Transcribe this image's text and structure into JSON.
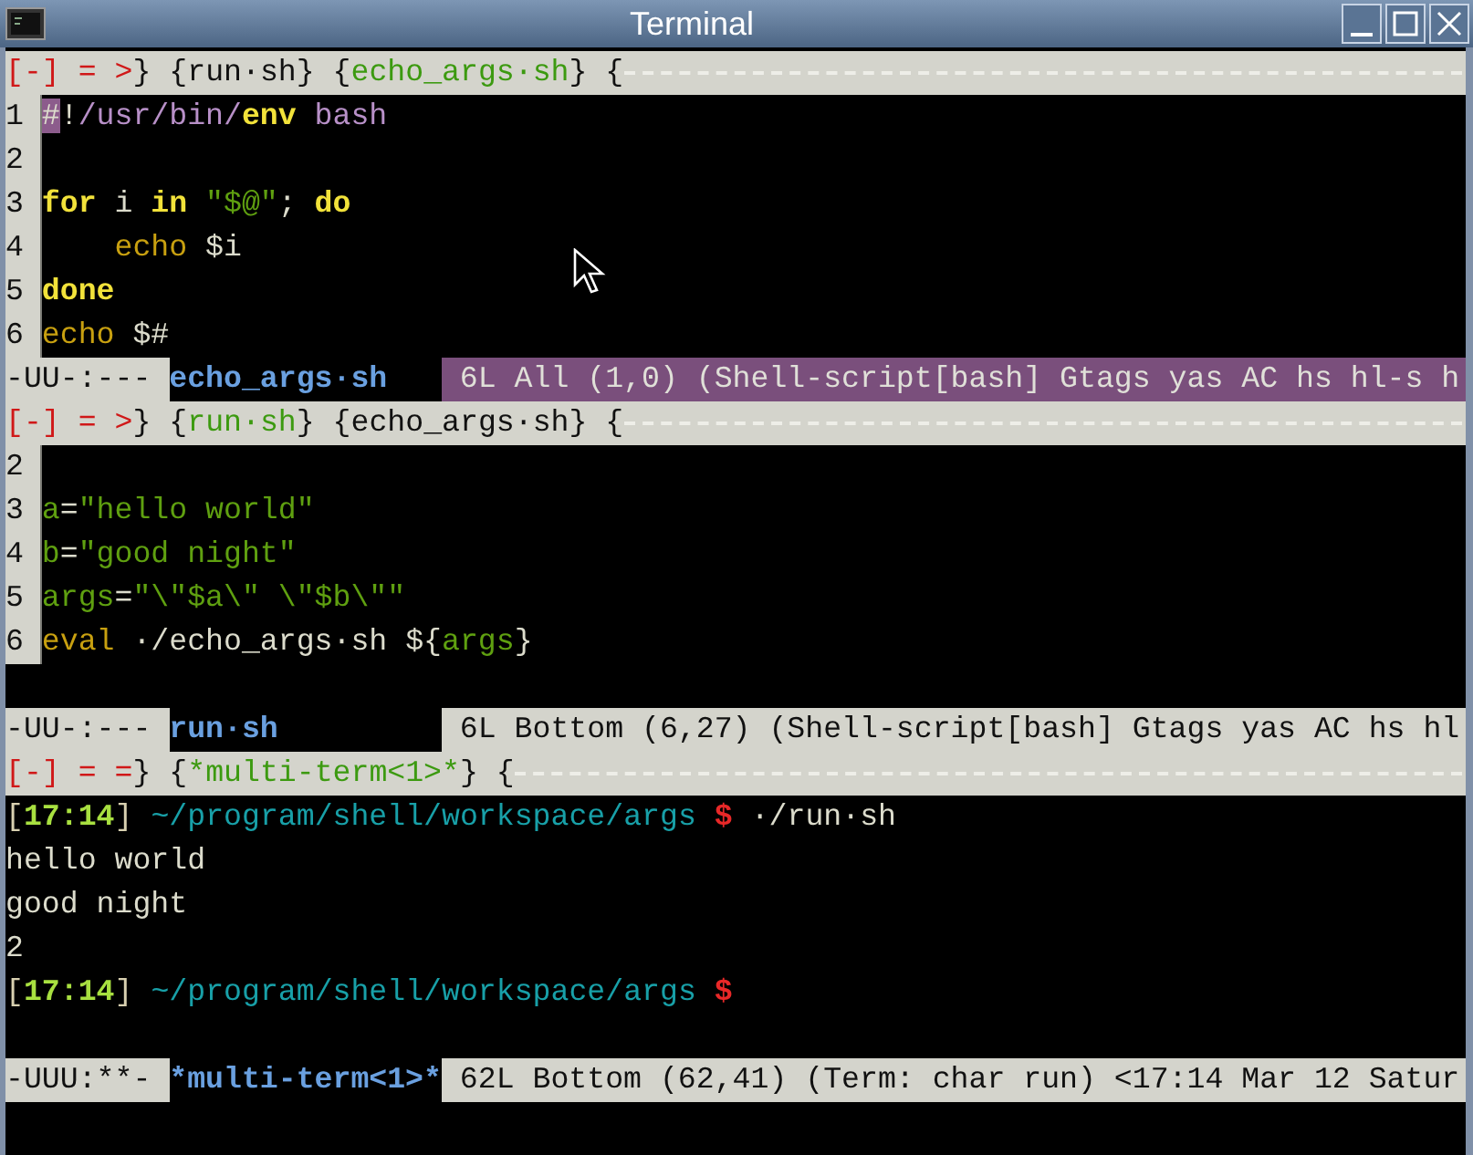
{
  "window": {
    "title": "Terminal"
  },
  "panes": [
    {
      "kind": "editor",
      "active": true,
      "tabbar": {
        "buttons": [
          "[-]",
          "=",
          ">"
        ],
        "buttons_end": "}",
        "tail": "{",
        "tabs": [
          {
            "open": "{",
            "label": "run·sh",
            "close": "}",
            "selected": false
          },
          {
            "open": "{",
            "label": "echo_args·sh",
            "close": "}",
            "selected": true
          }
        ]
      },
      "lines": [
        {
          "number": "1",
          "tokens": [
            {
              "kind": "cursor",
              "text": "#"
            },
            {
              "kind": "plain",
              "text": "!"
            },
            {
              "kind": "path",
              "text": "/usr/bin/"
            },
            {
              "kind": "keyword",
              "text": "env"
            },
            {
              "kind": "path",
              "text": " bash"
            }
          ]
        },
        {
          "number": "2"
        },
        {
          "number": "3",
          "tokens": [
            {
              "kind": "keyword",
              "text": "for"
            },
            {
              "kind": "plain",
              "text": " i "
            },
            {
              "kind": "keyword",
              "text": "in"
            },
            {
              "kind": "string",
              "text": " \"$@\""
            },
            {
              "kind": "plain",
              "text": "; "
            },
            {
              "kind": "keyword",
              "text": "do"
            }
          ]
        },
        {
          "number": "4",
          "tokens": [
            {
              "kind": "builtin",
              "text": "    echo"
            },
            {
              "kind": "plain",
              "text": " $i"
            }
          ]
        },
        {
          "number": "5",
          "tokens": [
            {
              "kind": "keyword",
              "text": "done"
            }
          ]
        },
        {
          "number": "6",
          "tokens": [
            {
              "kind": "builtin",
              "text": "echo"
            },
            {
              "kind": "plain",
              "text": " $#"
            }
          ]
        }
      ],
      "modeline": {
        "flags": "-UU-:---",
        "buffer": "echo_args·sh",
        "info": "6L All (1,0) (Shell-script[bash] Gtags yas AC hs hl-s h"
      }
    },
    {
      "kind": "editor",
      "active": false,
      "tabbar": {
        "buttons": [
          "[-]",
          "=",
          ">"
        ],
        "buttons_end": "}",
        "tail": "{",
        "tabs": [
          {
            "open": "{",
            "label": "run·sh",
            "close": "}",
            "selected": true
          },
          {
            "open": "{",
            "label": "echo_args·sh",
            "close": "}",
            "selected": false
          }
        ]
      },
      "lines": [
        {
          "number": "2"
        },
        {
          "number": "3",
          "tokens": [
            {
              "kind": "var",
              "text": "a"
            },
            {
              "kind": "plain",
              "text": "="
            },
            {
              "kind": "string",
              "text": "\"hello world\""
            }
          ]
        },
        {
          "number": "4",
          "tokens": [
            {
              "kind": "var",
              "text": "b"
            },
            {
              "kind": "plain",
              "text": "="
            },
            {
              "kind": "string",
              "text": "\"good night\""
            }
          ]
        },
        {
          "number": "5",
          "tokens": [
            {
              "kind": "var",
              "text": "args"
            },
            {
              "kind": "plain",
              "text": "="
            },
            {
              "kind": "string",
              "text": "\"\\\"$a\\\" \\\"$b\\\"\""
            }
          ]
        },
        {
          "number": "6",
          "tokens": [
            {
              "kind": "builtin",
              "text": "eval"
            },
            {
              "kind": "plain",
              "text": " ·/echo_args·sh ${"
            },
            {
              "kind": "var",
              "text": "args"
            },
            {
              "kind": "plain",
              "text": "}"
            }
          ]
        }
      ],
      "modeline": {
        "flags": "-UU-:---",
        "buffer": "run·sh",
        "info": "6L Bottom (6,27) (Shell-script[bash] Gtags yas AC hs hl"
      }
    },
    {
      "kind": "terminal",
      "active": false,
      "tabbar": {
        "buttons": [
          "[-]",
          "=",
          "="
        ],
        "buttons_end": "}",
        "tail": "{",
        "tabs": [
          {
            "open": "{",
            "label": "*multi-term<1>*",
            "close": "}",
            "selected": true
          }
        ]
      },
      "lines": [
        {
          "tokens": [
            {
              "kind": "bracket",
              "text": "["
            },
            {
              "kind": "time",
              "text": "17:14"
            },
            {
              "kind": "bracket",
              "text": "]"
            },
            {
              "kind": "dir",
              "text": " ~/program/shell/workspace/args"
            },
            {
              "kind": "prompt",
              "text": " $"
            },
            {
              "kind": "plain",
              "text": " ·/run·sh"
            }
          ]
        },
        {
          "tokens": [
            {
              "kind": "plain",
              "text": "hello world"
            }
          ]
        },
        {
          "tokens": [
            {
              "kind": "plain",
              "text": "good night"
            }
          ]
        },
        {
          "tokens": [
            {
              "kind": "plain",
              "text": "2"
            }
          ]
        },
        {
          "tokens": [
            {
              "kind": "bracket",
              "text": "["
            },
            {
              "kind": "time",
              "text": "17:14"
            },
            {
              "kind": "bracket",
              "text": "]"
            },
            {
              "kind": "dir",
              "text": " ~/program/shell/workspace/args"
            },
            {
              "kind": "prompt",
              "text": " $"
            }
          ]
        }
      ],
      "modeline": {
        "flags": "-UUU:**-",
        "buffer": "*multi-term<1>*",
        "info": "62L Bottom (62,41) (Term: char run) <17:14 Mar 12 Satur"
      }
    }
  ]
}
